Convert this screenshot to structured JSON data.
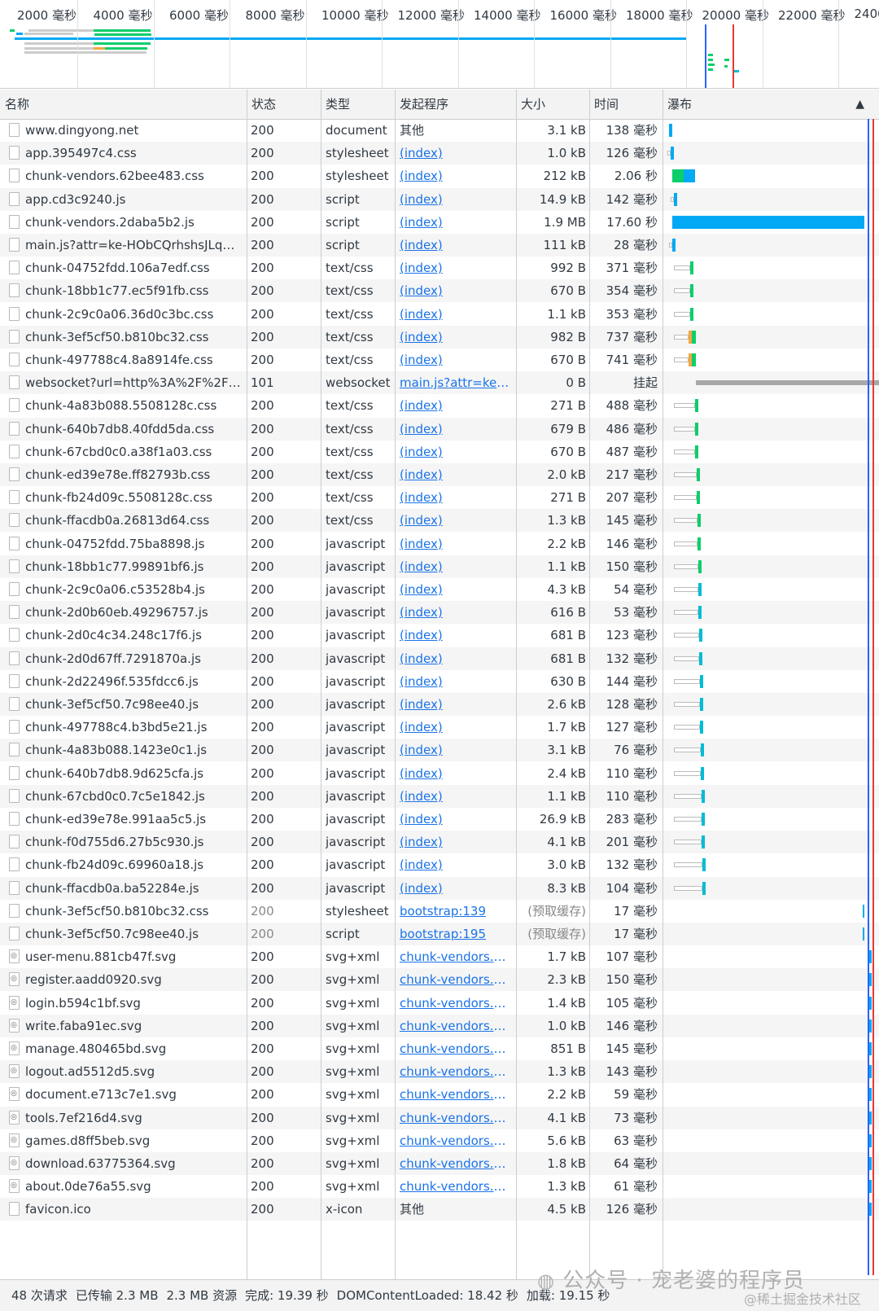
{
  "overview": {
    "ticks": [
      "2000 毫秒",
      "4000 毫秒",
      "6000 毫秒",
      "8000 毫秒",
      "10000 毫秒",
      "12000 毫秒",
      "14000 毫秒",
      "16000 毫秒",
      "18000 毫秒",
      "20000 毫秒",
      "22000 毫秒",
      "2400"
    ]
  },
  "columns": {
    "name": "名称",
    "status": "状态",
    "type": "类型",
    "initiator": "发起程序",
    "size": "大小",
    "time": "时间",
    "waterfall": "瀑布"
  },
  "rows": [
    {
      "name": "www.dingyong.net",
      "status": "200",
      "type": "document",
      "initiator": "其他",
      "link": false,
      "size": "3.1 kB",
      "time": "138 毫秒"
    },
    {
      "name": "app.395497c4.css",
      "status": "200",
      "type": "stylesheet",
      "initiator": "(index)",
      "link": true,
      "size": "1.0 kB",
      "time": "126 毫秒"
    },
    {
      "name": "chunk-vendors.62bee483.css",
      "status": "200",
      "type": "stylesheet",
      "initiator": "(index)",
      "link": true,
      "size": "212 kB",
      "time": "2.06 秒"
    },
    {
      "name": "app.cd3c9240.js",
      "status": "200",
      "type": "script",
      "initiator": "(index)",
      "link": true,
      "size": "14.9 kB",
      "time": "142 毫秒"
    },
    {
      "name": "chunk-vendors.2daba5b2.js",
      "status": "200",
      "type": "script",
      "initiator": "(index)",
      "link": true,
      "size": "1.9 MB",
      "time": "17.60 秒"
    },
    {
      "name": "main.js?attr=ke-HObCQrhshsJLqmU...",
      "status": "200",
      "type": "script",
      "initiator": "(index)",
      "link": true,
      "size": "111 kB",
      "time": "28 毫秒"
    },
    {
      "name": "chunk-04752fdd.106a7edf.css",
      "status": "200",
      "type": "text/css",
      "initiator": "(index)",
      "link": true,
      "size": "992 B",
      "time": "371 毫秒"
    },
    {
      "name": "chunk-18bb1c77.ec5f91fb.css",
      "status": "200",
      "type": "text/css",
      "initiator": "(index)",
      "link": true,
      "size": "670 B",
      "time": "354 毫秒"
    },
    {
      "name": "chunk-2c9c0a06.36d0c3bc.css",
      "status": "200",
      "type": "text/css",
      "initiator": "(index)",
      "link": true,
      "size": "1.1 kB",
      "time": "353 毫秒"
    },
    {
      "name": "chunk-3ef5cf50.b810bc32.css",
      "status": "200",
      "type": "text/css",
      "initiator": "(index)",
      "link": true,
      "size": "982 B",
      "time": "737 毫秒"
    },
    {
      "name": "chunk-497788c4.8a8914fe.css",
      "status": "200",
      "type": "text/css",
      "initiator": "(index)",
      "link": true,
      "size": "670 B",
      "time": "741 毫秒"
    },
    {
      "name": "websocket?url=http%3A%2F%2Fww...",
      "status": "101",
      "type": "websocket",
      "initiator": "main.js?attr=ke-H...",
      "link": true,
      "size": "0 B",
      "time": "挂起"
    },
    {
      "name": "chunk-4a83b088.5508128c.css",
      "status": "200",
      "type": "text/css",
      "initiator": "(index)",
      "link": true,
      "size": "271 B",
      "time": "488 毫秒"
    },
    {
      "name": "chunk-640b7db8.40fdd5da.css",
      "status": "200",
      "type": "text/css",
      "initiator": "(index)",
      "link": true,
      "size": "679 B",
      "time": "486 毫秒"
    },
    {
      "name": "chunk-67cbd0c0.a38f1a03.css",
      "status": "200",
      "type": "text/css",
      "initiator": "(index)",
      "link": true,
      "size": "670 B",
      "time": "487 毫秒"
    },
    {
      "name": "chunk-ed39e78e.ff82793b.css",
      "status": "200",
      "type": "text/css",
      "initiator": "(index)",
      "link": true,
      "size": "2.0 kB",
      "time": "217 毫秒"
    },
    {
      "name": "chunk-fb24d09c.5508128c.css",
      "status": "200",
      "type": "text/css",
      "initiator": "(index)",
      "link": true,
      "size": "271 B",
      "time": "207 毫秒"
    },
    {
      "name": "chunk-ffacdb0a.26813d64.css",
      "status": "200",
      "type": "text/css",
      "initiator": "(index)",
      "link": true,
      "size": "1.3 kB",
      "time": "145 毫秒"
    },
    {
      "name": "chunk-04752fdd.75ba8898.js",
      "status": "200",
      "type": "javascript",
      "initiator": "(index)",
      "link": true,
      "size": "2.2 kB",
      "time": "146 毫秒"
    },
    {
      "name": "chunk-18bb1c77.99891bf6.js",
      "status": "200",
      "type": "javascript",
      "initiator": "(index)",
      "link": true,
      "size": "1.1 kB",
      "time": "150 毫秒"
    },
    {
      "name": "chunk-2c9c0a06.c53528b4.js",
      "status": "200",
      "type": "javascript",
      "initiator": "(index)",
      "link": true,
      "size": "4.3 kB",
      "time": "54 毫秒"
    },
    {
      "name": "chunk-2d0b60eb.49296757.js",
      "status": "200",
      "type": "javascript",
      "initiator": "(index)",
      "link": true,
      "size": "616 B",
      "time": "53 毫秒"
    },
    {
      "name": "chunk-2d0c4c34.248c17f6.js",
      "status": "200",
      "type": "javascript",
      "initiator": "(index)",
      "link": true,
      "size": "681 B",
      "time": "123 毫秒"
    },
    {
      "name": "chunk-2d0d67ff.7291870a.js",
      "status": "200",
      "type": "javascript",
      "initiator": "(index)",
      "link": true,
      "size": "681 B",
      "time": "132 毫秒"
    },
    {
      "name": "chunk-2d22496f.535fdcc6.js",
      "status": "200",
      "type": "javascript",
      "initiator": "(index)",
      "link": true,
      "size": "630 B",
      "time": "144 毫秒"
    },
    {
      "name": "chunk-3ef5cf50.7c98ee40.js",
      "status": "200",
      "type": "javascript",
      "initiator": "(index)",
      "link": true,
      "size": "2.6 kB",
      "time": "128 毫秒"
    },
    {
      "name": "chunk-497788c4.b3bd5e21.js",
      "status": "200",
      "type": "javascript",
      "initiator": "(index)",
      "link": true,
      "size": "1.7 kB",
      "time": "127 毫秒"
    },
    {
      "name": "chunk-4a83b088.1423e0c1.js",
      "status": "200",
      "type": "javascript",
      "initiator": "(index)",
      "link": true,
      "size": "3.1 kB",
      "time": "76 毫秒"
    },
    {
      "name": "chunk-640b7db8.9d625cfa.js",
      "status": "200",
      "type": "javascript",
      "initiator": "(index)",
      "link": true,
      "size": "2.4 kB",
      "time": "110 毫秒"
    },
    {
      "name": "chunk-67cbd0c0.7c5e1842.js",
      "status": "200",
      "type": "javascript",
      "initiator": "(index)",
      "link": true,
      "size": "1.1 kB",
      "time": "110 毫秒"
    },
    {
      "name": "chunk-ed39e78e.991aa5c5.js",
      "status": "200",
      "type": "javascript",
      "initiator": "(index)",
      "link": true,
      "size": "26.9 kB",
      "time": "283 毫秒"
    },
    {
      "name": "chunk-f0d755d6.27b5c930.js",
      "status": "200",
      "type": "javascript",
      "initiator": "(index)",
      "link": true,
      "size": "4.1 kB",
      "time": "201 毫秒"
    },
    {
      "name": "chunk-fb24d09c.69960a18.js",
      "status": "200",
      "type": "javascript",
      "initiator": "(index)",
      "link": true,
      "size": "3.0 kB",
      "time": "132 毫秒"
    },
    {
      "name": "chunk-ffacdb0a.ba52284e.js",
      "status": "200",
      "type": "javascript",
      "initiator": "(index)",
      "link": true,
      "size": "8.3 kB",
      "time": "104 毫秒"
    },
    {
      "name": "chunk-3ef5cf50.b810bc32.css",
      "status": "200",
      "type": "stylesheet",
      "initiator": "bootstrap:139",
      "link": true,
      "size": "(预取缓存)",
      "time": "17 毫秒",
      "grey": true
    },
    {
      "name": "chunk-3ef5cf50.7c98ee40.js",
      "status": "200",
      "type": "script",
      "initiator": "bootstrap:195",
      "link": true,
      "size": "(预取缓存)",
      "time": "17 毫秒",
      "grey": true
    },
    {
      "name": "user-menu.881cb47f.svg",
      "status": "200",
      "type": "svg+xml",
      "initiator": "chunk-vendors.2d...",
      "link": true,
      "size": "1.7 kB",
      "time": "107 毫秒"
    },
    {
      "name": "register.aadd0920.svg",
      "status": "200",
      "type": "svg+xml",
      "initiator": "chunk-vendors.2d...",
      "link": true,
      "size": "2.3 kB",
      "time": "150 毫秒"
    },
    {
      "name": "login.b594c1bf.svg",
      "status": "200",
      "type": "svg+xml",
      "initiator": "chunk-vendors.2d...",
      "link": true,
      "size": "1.4 kB",
      "time": "105 毫秒"
    },
    {
      "name": "write.faba91ec.svg",
      "status": "200",
      "type": "svg+xml",
      "initiator": "chunk-vendors.2d...",
      "link": true,
      "size": "1.0 kB",
      "time": "146 毫秒"
    },
    {
      "name": "manage.480465bd.svg",
      "status": "200",
      "type": "svg+xml",
      "initiator": "chunk-vendors.2d...",
      "link": true,
      "size": "851 B",
      "time": "145 毫秒"
    },
    {
      "name": "logout.ad5512d5.svg",
      "status": "200",
      "type": "svg+xml",
      "initiator": "chunk-vendors.2d...",
      "link": true,
      "size": "1.3 kB",
      "time": "143 毫秒"
    },
    {
      "name": "document.e713c7e1.svg",
      "status": "200",
      "type": "svg+xml",
      "initiator": "chunk-vendors.2d...",
      "link": true,
      "size": "2.2 kB",
      "time": "59 毫秒"
    },
    {
      "name": "tools.7ef216d4.svg",
      "status": "200",
      "type": "svg+xml",
      "initiator": "chunk-vendors.2d...",
      "link": true,
      "size": "4.1 kB",
      "time": "73 毫秒"
    },
    {
      "name": "games.d8ff5beb.svg",
      "status": "200",
      "type": "svg+xml",
      "initiator": "chunk-vendors.2d...",
      "link": true,
      "size": "5.6 kB",
      "time": "63 毫秒"
    },
    {
      "name": "download.63775364.svg",
      "status": "200",
      "type": "svg+xml",
      "initiator": "chunk-vendors.2d...",
      "link": true,
      "size": "1.8 kB",
      "time": "64 毫秒"
    },
    {
      "name": "about.0de76a55.svg",
      "status": "200",
      "type": "svg+xml",
      "initiator": "chunk-vendors.2d...",
      "link": true,
      "size": "1.3 kB",
      "time": "61 毫秒"
    },
    {
      "name": "favicon.ico",
      "status": "200",
      "type": "x-icon",
      "initiator": "其他",
      "link": false,
      "size": "4.5 kB",
      "time": "126 毫秒"
    }
  ],
  "statusbar": {
    "requests": "48 次请求",
    "transferred": "已传输 2.3 MB",
    "resources": "2.3 MB 资源",
    "finish": "完成: 19.39 秒",
    "dcl": "DOMContentLoaded: 18.42 秒",
    "load": "加载: 19.15 秒"
  },
  "watermark": {
    "main": "公众号 · 宠老婆的程序员",
    "sub": "@稀土掘金技术社区"
  },
  "colors": {
    "blue": "#03a9f4",
    "green": "#0cce6b",
    "orange": "#f4a742",
    "teal": "#00bcd4",
    "grey_bar": "#a8a8a8",
    "dcl_line": "#2962ff",
    "load_line": "#e53935",
    "link": "#1a73e8"
  }
}
